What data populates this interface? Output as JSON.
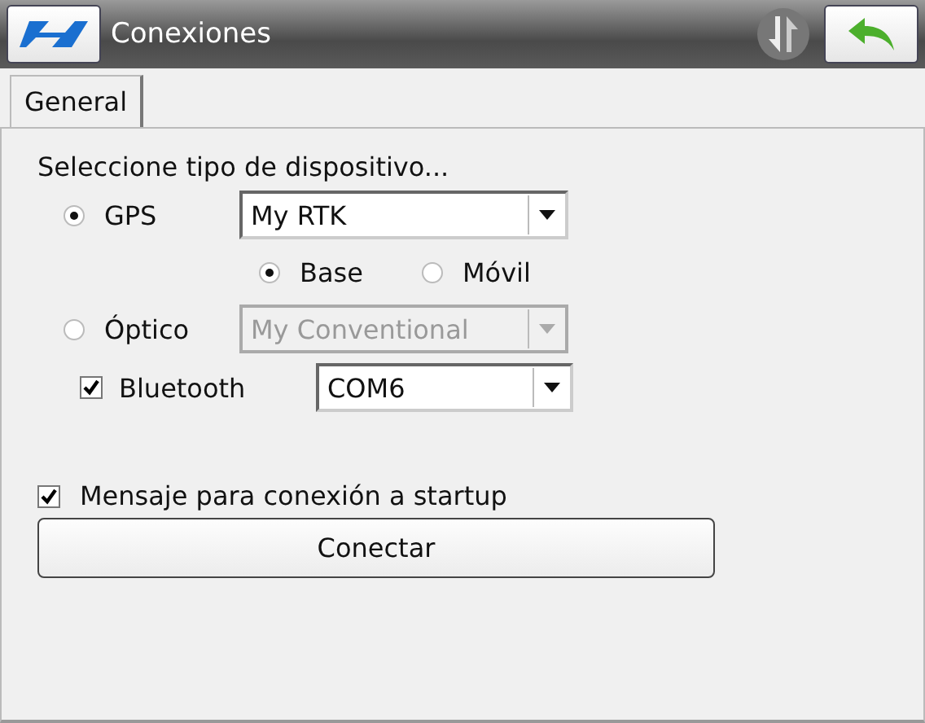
{
  "window": {
    "title": "Conexiones"
  },
  "tabs": [
    {
      "label": "General",
      "selected": true
    }
  ],
  "prompt": "Seleccione tipo de dispositivo...",
  "device_types": [
    {
      "label": "GPS",
      "selected": true,
      "dropdown": {
        "value": "My RTK",
        "disabled": false
      },
      "modes": [
        {
          "label": "Base",
          "selected": true
        },
        {
          "label": "Móvil",
          "selected": false
        }
      ]
    },
    {
      "label": "Óptico",
      "selected": false,
      "dropdown": {
        "value": "My Conventional",
        "disabled": true
      }
    }
  ],
  "bluetooth": {
    "label": "Bluetooth",
    "checked": true,
    "port": "COM6"
  },
  "startup_message": {
    "label": "Mensaje para conexión a startup",
    "checked": true
  },
  "connect_button": "Conectar"
}
